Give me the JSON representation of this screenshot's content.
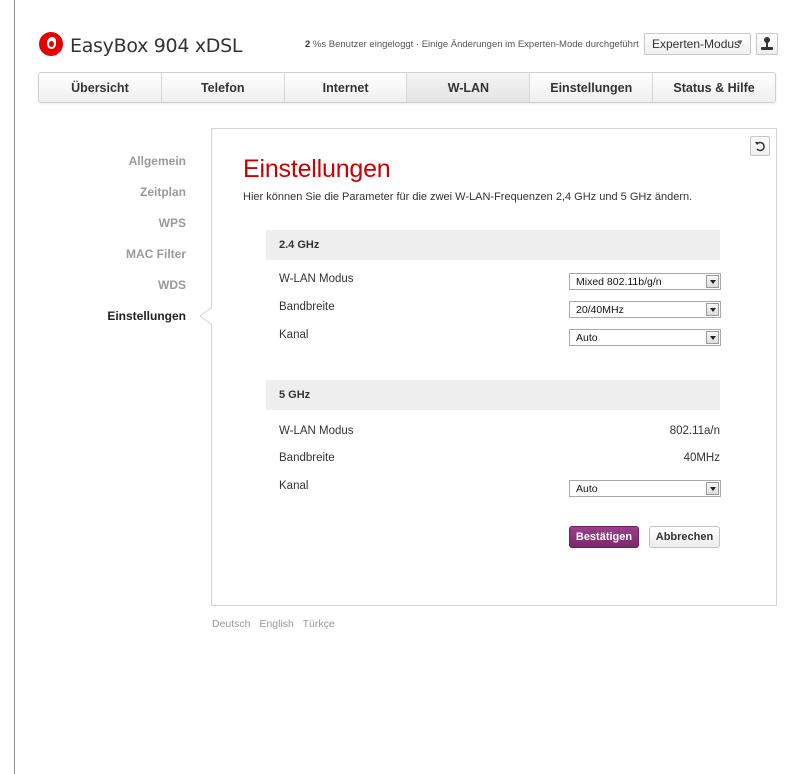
{
  "header": {
    "app_title": "EasyBox 904 xDSL",
    "status_count": "2",
    "status_text": " %s Benutzer eingeloggt · Einige Änderungen im Experten-Mode durchgeführt",
    "mode_selected": "Experten-Modus"
  },
  "nav": {
    "tabs": [
      "Übersicht",
      "Telefon",
      "Internet",
      "W-LAN",
      "Einstellungen",
      "Status & Hilfe"
    ],
    "active": "W-LAN"
  },
  "sidebar": {
    "items": [
      "Allgemein",
      "Zeitplan",
      "WPS",
      "MAC Filter",
      "WDS",
      "Einstellungen"
    ],
    "active": "Einstellungen"
  },
  "main": {
    "title": "Einstellungen",
    "description": "Hier können Sie die Parameter für die zwei W-LAN-Frequenzen 2,4 GHz und 5 GHz ändern.",
    "band24": {
      "heading": "2.4 GHz",
      "mode_label": "W-LAN Modus",
      "mode_value": "Mixed 802.11b/g/n",
      "bandwidth_label": "Bandbreite",
      "bandwidth_value": "20/40MHz",
      "channel_label": "Kanal",
      "channel_value": "Auto"
    },
    "band5": {
      "heading": "5 GHz",
      "mode_label": "W-LAN Modus",
      "mode_value": "802.11a/n",
      "bandwidth_label": "Bandbreite",
      "bandwidth_value": "40MHz",
      "channel_label": "Kanal",
      "channel_value": "Auto"
    },
    "confirm_label": "Bestätigen",
    "cancel_label": "Abbrechen"
  },
  "footer": {
    "languages": [
      "Deutsch",
      "English",
      "Türkçe"
    ]
  },
  "colors": {
    "brand_red": "#e60000",
    "title_red": "#cc0000",
    "confirm_purple": "#8a3479"
  },
  "icons": {
    "logo": "vodafone-logo-icon",
    "user": "user-icon",
    "reset": "undo-icon"
  }
}
